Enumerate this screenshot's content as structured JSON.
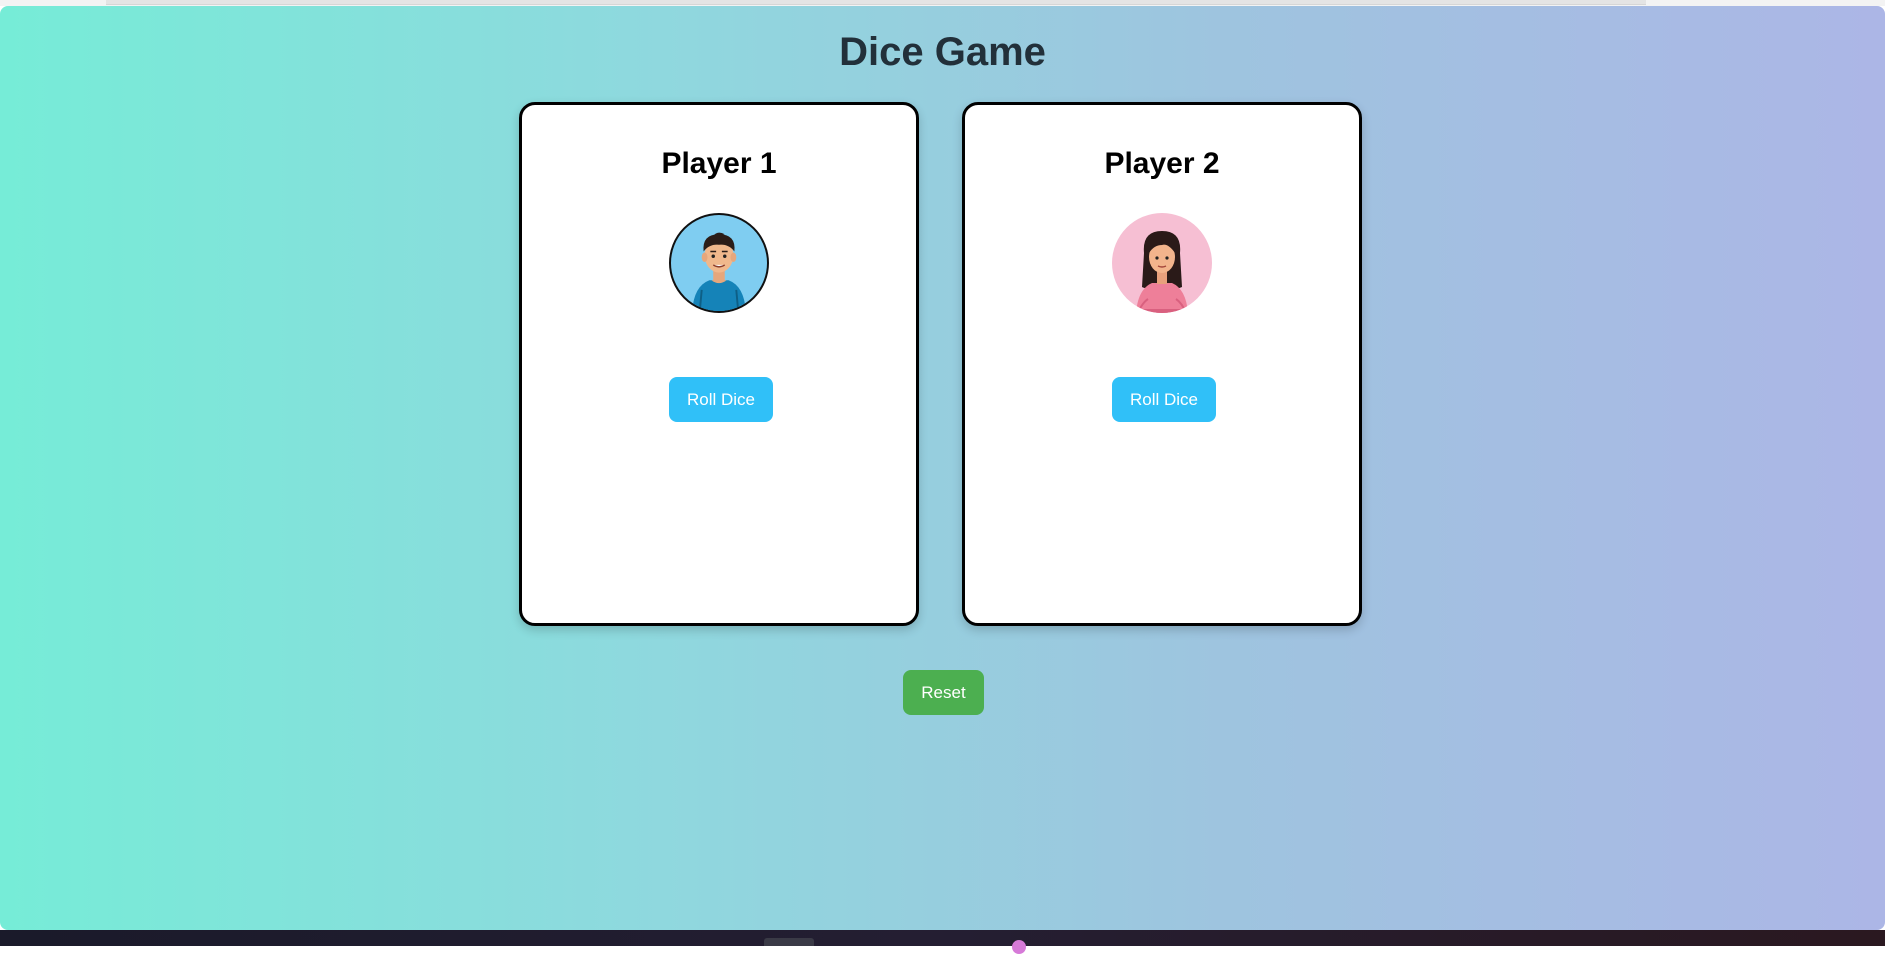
{
  "page": {
    "title": "Dice Game"
  },
  "players": [
    {
      "name": "Player 1",
      "avatar": "boy-avatar-icon",
      "avatar_bg": "#7fcdf1",
      "roll_label": "Roll Dice"
    },
    {
      "name": "Player 2",
      "avatar": "girl-avatar-icon",
      "avatar_bg": "#f6bfd3",
      "roll_label": "Roll Dice"
    }
  ],
  "controls": {
    "reset_label": "Reset"
  },
  "colors": {
    "roll_button": "#30c0f8",
    "reset_button": "#4caf50",
    "gradient_start": "#76ecd7",
    "gradient_end": "#acb6e6"
  }
}
